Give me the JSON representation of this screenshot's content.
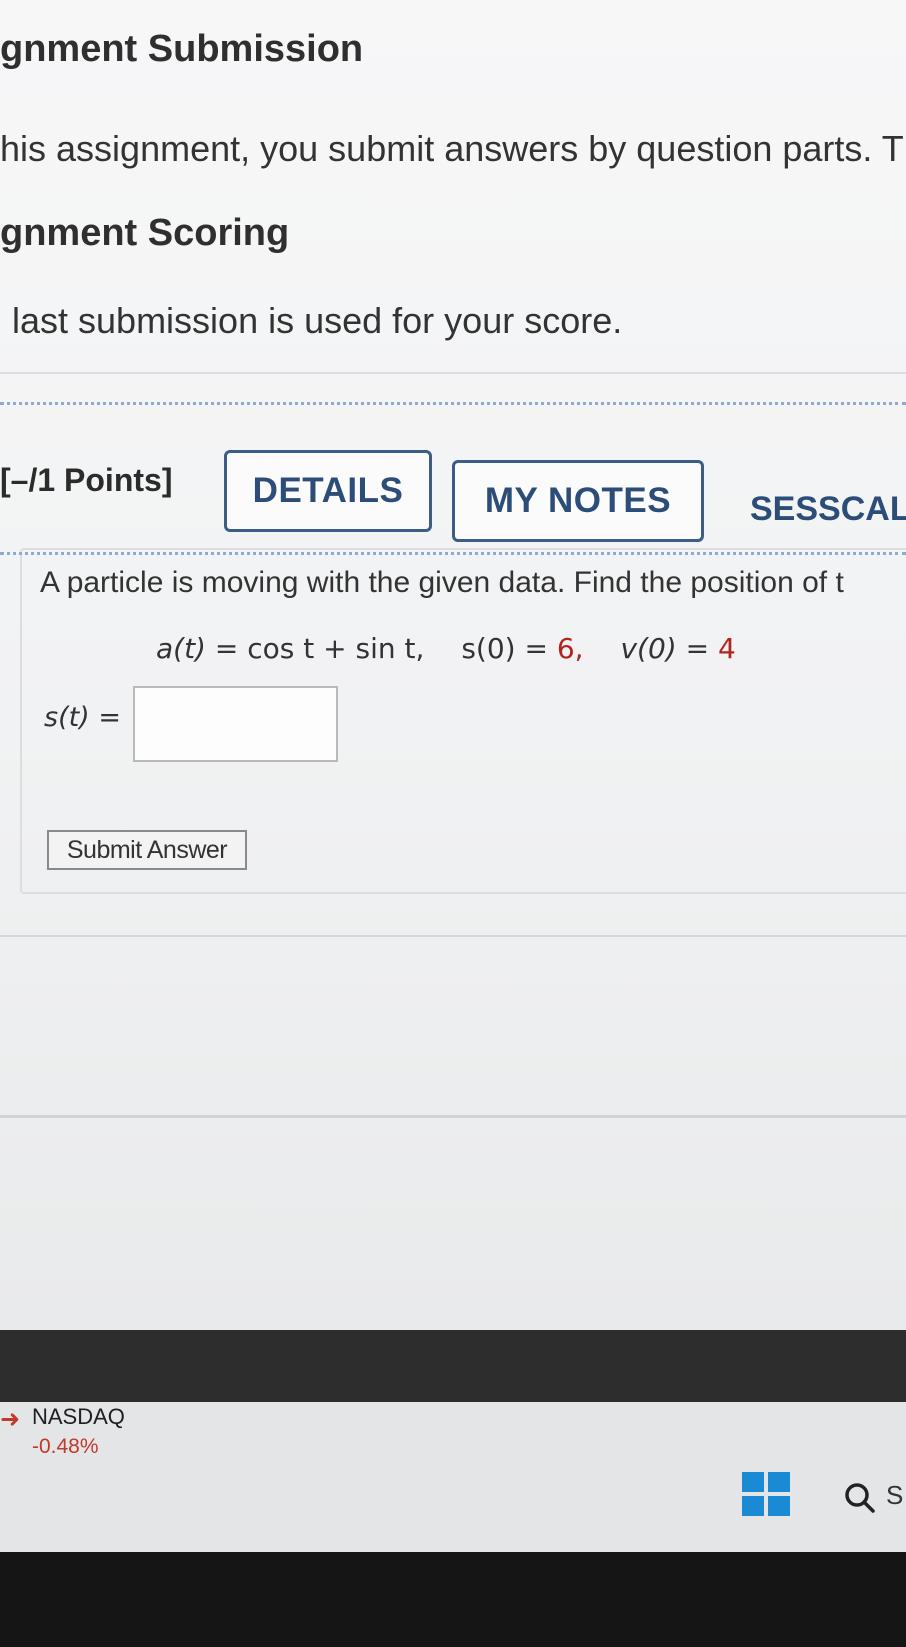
{
  "assignment": {
    "submission_heading": "gnment Submission",
    "submission_text": "his assignment, you submit answers by question parts. T",
    "scoring_heading": "gnment Scoring",
    "scoring_text": "last submission is used for your score."
  },
  "question": {
    "points": "[–/1 Points]",
    "details_label": "DETAILS",
    "notes_label": "MY NOTES",
    "source_label": "SESSCAL",
    "prompt": "A particle is moving with the given data. Find the position of t",
    "equation": {
      "a_lhs": "a(t)",
      "a_rhs": "= cos t + sin t,",
      "s0_lhs": "s(0)",
      "s0_eq": "=",
      "s0_val": "6,",
      "v0_lhs": "v(0)",
      "v0_eq": "=",
      "v0_val": "4"
    },
    "answer_label_var": "s(t)",
    "answer_label_eq": "=",
    "answer_value": "",
    "submit_label": "Submit Answer"
  },
  "taskbar": {
    "stock_name": "NASDAQ",
    "stock_change": "-0.48%",
    "search_letter": "S"
  },
  "colors": {
    "accent": "#2c4d78",
    "given_value": "#b0261f",
    "stock_down": "#c0392b",
    "windows_blue": "#1a8ad4"
  },
  "icons": [
    "windows-logo-icon",
    "search-icon",
    "trend-down-icon"
  ]
}
